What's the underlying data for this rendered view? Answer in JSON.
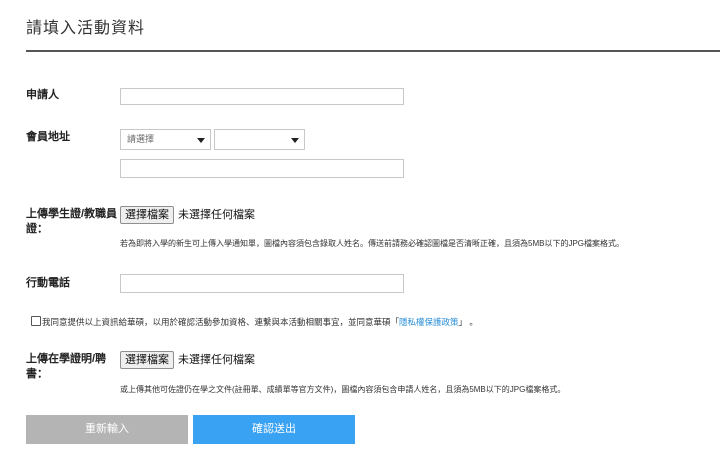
{
  "header": {
    "title": "請填入活動資料"
  },
  "form": {
    "applicant": {
      "label": "申請人",
      "value": ""
    },
    "address": {
      "label": "會員地址",
      "city_select": "請選擇",
      "district_select": "",
      "detail_value": ""
    },
    "student_id_upload": {
      "label_line1": "上傳學生證/教職員",
      "label_line2": "證：",
      "button": "選擇檔案",
      "status": "未選擇任何檔案",
      "hint": "若為即將入學的新生可上傳入學通知單，圖檔內容須包含錄取人姓名。傳送前請務必確認圖檔是否清晰正確，且須為5MB以下的JPG檔案格式。"
    },
    "mobile": {
      "label": "行動電話",
      "value": ""
    },
    "agreement": {
      "checked": false,
      "text_before": "我同意提供以上資訊給華碩，以用於確認活動參加資格、連繫與本活動相關事宜，並同意華碩「",
      "link": "隱私權保護政策",
      "text_after": "」 。"
    },
    "enrollment_upload": {
      "label_line1": "上傳在學證明/聘",
      "label_line2": "書：",
      "button": "選擇檔案",
      "status": "未選擇任何檔案",
      "hint": "或上傳其他可佐證仍在學之文件(註冊單、成績單等官方文件)，圖檔內容須包含申請人姓名，且須為5MB以下的JPG檔案格式。"
    }
  },
  "actions": {
    "reset": "重新輸入",
    "submit": "確認送出"
  },
  "colors": {
    "submit": "#3aa2f2",
    "reset": "#b4b4b4",
    "link": "#2a8ed8"
  }
}
